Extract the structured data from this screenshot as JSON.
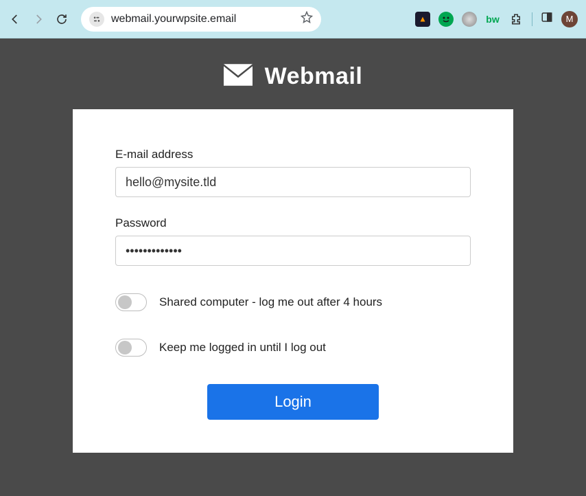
{
  "browser": {
    "url": "webmail.yourwpsite.email",
    "avatar_initial": "M",
    "ext_d_label": "bw"
  },
  "brand": "Webmail",
  "form": {
    "email_label": "E-mail address",
    "email_value": "hello@mysite.tld",
    "password_label": "Password",
    "password_value": "•••••••••••••",
    "shared_label": "Shared computer - log me out after 4 hours",
    "keep_label": "Keep me logged in until I log out",
    "login_button": "Login"
  }
}
